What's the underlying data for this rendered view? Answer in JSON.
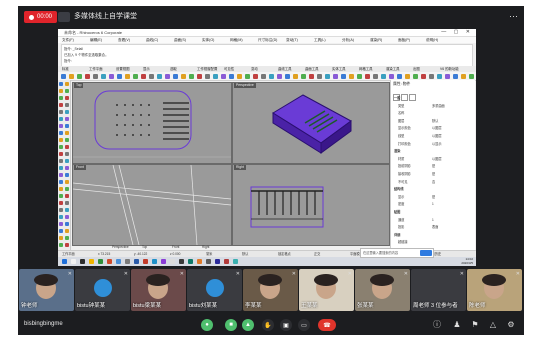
{
  "recording": {
    "label": "00:00"
  },
  "meeting": {
    "title": "多媒体线上自学课堂"
  },
  "colors": {
    "accent_green": "#4fbf6e",
    "hangup_red": "#e0342b",
    "record_red": "#e0242b",
    "selection_purple": "#6a3bd6"
  },
  "screen": {
    "title": "未命名 - Rhinoceros 6 Corporate",
    "window_controls": "— ▢ ✕",
    "menus": [
      "文件(F)",
      "编辑(E)",
      "查看(V)",
      "曲线(C)",
      "曲面(S)",
      "实体(O)",
      "网格(M)",
      "尺寸标注(D)",
      "变动(T)",
      "工具(L)",
      "分析(A)",
      "渲染(R)",
      "面板(P)",
      "说明(H)"
    ],
    "command_lines": [
      "指令: _Selall",
      "已加入 9 个物件至选取集合。",
      "指令:"
    ],
    "toolbar_tabs": [
      "标准",
      "工作平面",
      "设置视图",
      "显示",
      "选取",
      "工作视窗配置",
      "可见性",
      "变动",
      "曲线工具",
      "曲面工具",
      "实体工具",
      "网格工具",
      "渲染工具",
      "出图",
      "V6 的新功能"
    ],
    "viewports": {
      "top": "Top",
      "perspective": "Perspective",
      "front": "Front",
      "right": "Right"
    },
    "viewport_tabs": [
      "Perspective",
      "Top",
      "Front",
      "Right"
    ],
    "properties": {
      "header": "属性: 物件",
      "rows": [
        {
          "k": "一般",
          "v": "",
          "section": true
        },
        {
          "k": "类型",
          "v": "多重曲面"
        },
        {
          "k": "名称",
          "v": ""
        },
        {
          "k": "图层",
          "v": "默认"
        },
        {
          "k": "显示颜色",
          "v": "以图层"
        },
        {
          "k": "线型",
          "v": "以图层"
        },
        {
          "k": "打印颜色",
          "v": "以显示"
        },
        {
          "k": "渲染",
          "v": "",
          "section": true
        },
        {
          "k": "材质",
          "v": "以图层"
        },
        {
          "k": "投射阴影",
          "v": "是"
        },
        {
          "k": "接收阴影",
          "v": "是"
        },
        {
          "k": "不可见",
          "v": "否"
        },
        {
          "k": "结构线",
          "v": "",
          "section": true
        },
        {
          "k": "显示",
          "v": "是"
        },
        {
          "k": "密度",
          "v": "1"
        },
        {
          "k": "贴图",
          "v": "",
          "section": true
        },
        {
          "k": "通道",
          "v": "1"
        },
        {
          "k": "投影",
          "v": "表面"
        },
        {
          "k": "详细",
          "v": "",
          "section": true
        },
        {
          "k": "超链接",
          "v": ""
        }
      ]
    },
    "status": [
      "工作平面",
      "x 73.215",
      "y -40.122",
      "z 0.000",
      "毫米",
      "默认",
      "锁定格点",
      "正交",
      "平面模式",
      "物件锁点",
      "记录建构历史"
    ],
    "search_popup": {
      "placeholder": "在这里输入要搜索的内容"
    },
    "clock": {
      "time": "14:02",
      "date": "2020/3/5"
    }
  },
  "participants": [
    {
      "name": "钟老师",
      "bg": "#5a6f8a"
    },
    {
      "name": "bistu钟某某",
      "bg": "#3a3b40"
    },
    {
      "name": "bistu梁某某",
      "bg": "#6b4a4a"
    },
    {
      "name": "bistu刘某某",
      "bg": "#3a3b40"
    },
    {
      "name": "李某某",
      "bg": "#6a5a48"
    },
    {
      "name": "王某某",
      "bg": "#d8d0c0"
    },
    {
      "name": "张某某",
      "bg": "#8a8070"
    },
    {
      "name": "周老师 3 位参与者",
      "bg": "#3a3b40"
    },
    {
      "name": "陈老师",
      "bg": "#b9a37a"
    }
  ],
  "bottom": {
    "user": "bisbingbingme"
  },
  "icons": [
    "record-dot-icon",
    "meeting-icon",
    "more-icon",
    "mic-icon",
    "camera-icon",
    "share-screen-icon",
    "hand-icon",
    "chat-icon",
    "hangup-icon",
    "info-icon",
    "participants-icon",
    "layout-icon",
    "record-icon",
    "settings-icon"
  ]
}
